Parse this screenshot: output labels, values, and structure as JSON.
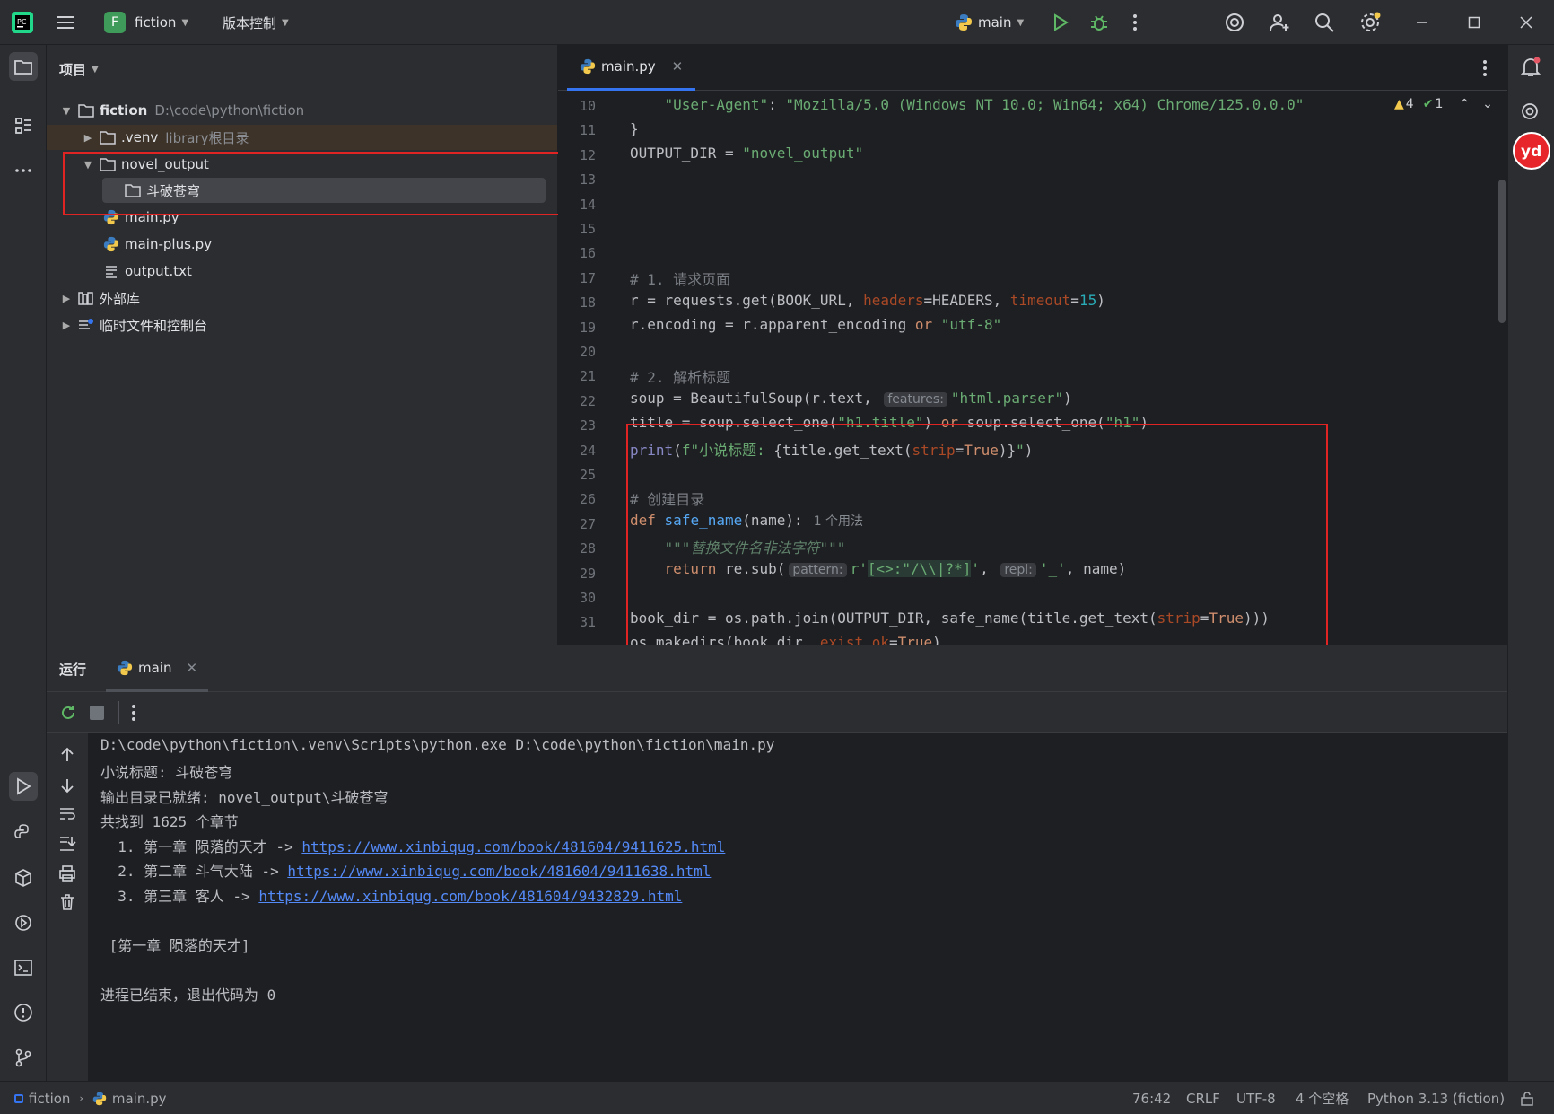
{
  "titlebar": {
    "project_badge": "F",
    "project_name": "fiction",
    "vcs_menu": "版本控制",
    "run_config": "main"
  },
  "project_pane": {
    "header": "项目",
    "tree": {
      "root_name": "fiction",
      "root_path": "D:\\code\\python\\fiction",
      "venv_name": ".venv",
      "venv_note": "library根目录",
      "novel_output": "novel_output",
      "subfolder": "斗破苍穹",
      "file_main": "main.py",
      "file_main_plus": "main-plus.py",
      "file_output": "output.txt",
      "external_libs": "外部库",
      "scratches": "临时文件和控制台"
    }
  },
  "editor": {
    "tab_label": "main.py",
    "warnings_count": "4",
    "ok_count": "1",
    "line_numbers": [
      "10",
      "11",
      "12",
      "13",
      "14",
      "15",
      "16",
      "17",
      "18",
      "19",
      "20",
      "21",
      "22",
      "23",
      "24",
      "25",
      "26",
      "27",
      "28",
      "29",
      "30",
      "31"
    ],
    "usage_hint": "1 个用法",
    "hint_features": "features:",
    "hint_pattern": "pattern:",
    "hint_repl": "repl:"
  },
  "run_panel": {
    "tab_run": "运行",
    "tab_main": "main",
    "output": {
      "cmd": "D:\\code\\python\\fiction\\.venv\\Scripts\\python.exe D:\\code\\python\\fiction\\main.py",
      "title_line": "小说标题: 斗破苍穹",
      "dir_line": "输出目录已就绪: novel_output\\斗破苍穹",
      "found_line": "共找到 1625 个章节",
      "ch1_prefix": "  1. 第一章 陨落的天才 -> ",
      "ch1_url": "https://www.xinbiqug.com/book/481604/9411625.html",
      "ch2_prefix": "  2. 第二章 斗气大陆 -> ",
      "ch2_url": "https://www.xinbiqug.com/book/481604/9411638.html",
      "ch3_prefix": "  3. 第三章 客人 -> ",
      "ch3_url": "https://www.xinbiqug.com/book/481604/9432829.html",
      "chapter_header": " [第一章 陨落的天才]",
      "exit_line": "进程已结束，退出代码为 0"
    }
  },
  "statusbar": {
    "project": "fiction",
    "file": "main.py",
    "position": "76:42",
    "line_sep": "CRLF",
    "encoding": "UTF-8",
    "indent": "4 个空格",
    "interpreter": "Python 3.13 (fiction)"
  },
  "colors": {
    "accent": "#3574f0",
    "highlight_box": "#e02424",
    "run_green": "#5fb865"
  }
}
